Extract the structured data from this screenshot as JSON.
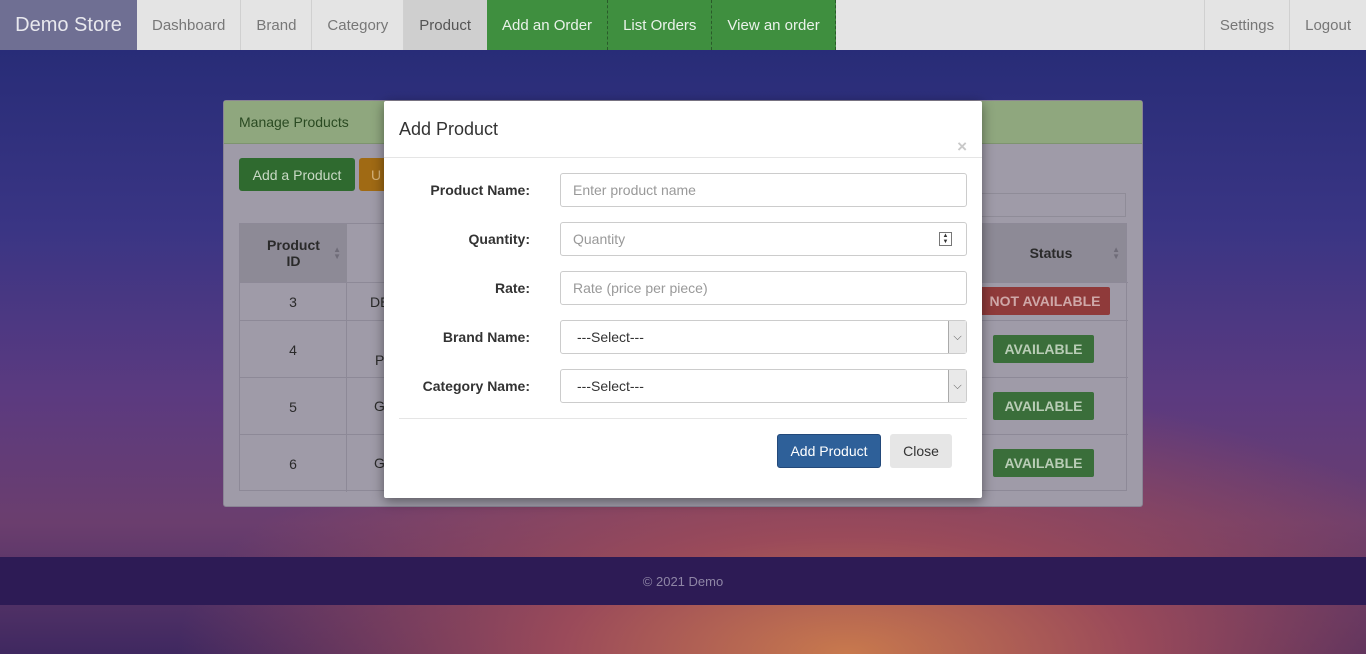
{
  "navbar": {
    "brand": "Demo Store",
    "items": [
      {
        "label": "Dashboard"
      },
      {
        "label": "Brand"
      },
      {
        "label": "Category"
      },
      {
        "label": "Product",
        "active": true
      },
      {
        "label": "Add an Order"
      },
      {
        "label": "List Orders"
      },
      {
        "label": "View an order"
      }
    ],
    "right_items": [
      {
        "label": "Settings"
      },
      {
        "label": "Logout"
      }
    ]
  },
  "panel": {
    "heading": "Manage Products",
    "add_button": "Add a Product",
    "update_button_fragment": "U",
    "table": {
      "headers": {
        "id": "Product ID",
        "status": "Status"
      },
      "rows": [
        {
          "id": "3",
          "name_fragment": "DE",
          "status": "NOT AVAILABLE"
        },
        {
          "id": "4",
          "name_fragment": "P",
          "status": "AVAILABLE"
        },
        {
          "id": "5",
          "name_fragment": "G",
          "status": "AVAILABLE"
        },
        {
          "id": "6",
          "name_fragment": "G",
          "status": "AVAILABLE"
        }
      ]
    }
  },
  "modal": {
    "title": "Add Product",
    "close_icon": "×",
    "fields": {
      "product_name": {
        "label": "Product Name:",
        "placeholder": "Enter product name",
        "value": ""
      },
      "quantity": {
        "label": "Quantity:",
        "placeholder": "Quantity",
        "value": ""
      },
      "rate": {
        "label": "Rate:",
        "placeholder": "Rate (price per piece)",
        "value": ""
      },
      "brand_name": {
        "label": "Brand Name:",
        "selected": "---Select---"
      },
      "category_name": {
        "label": "Category Name:",
        "selected": "---Select---"
      }
    },
    "submit_button": "Add Product",
    "close_button": "Close"
  },
  "footer": {
    "text": "© 2021 Demo"
  },
  "colors": {
    "nav_green": "#3f8f3f",
    "primary_button": "#2e6099",
    "status_available": "#3a6e3a",
    "status_not_available": "#8f3a3a"
  }
}
